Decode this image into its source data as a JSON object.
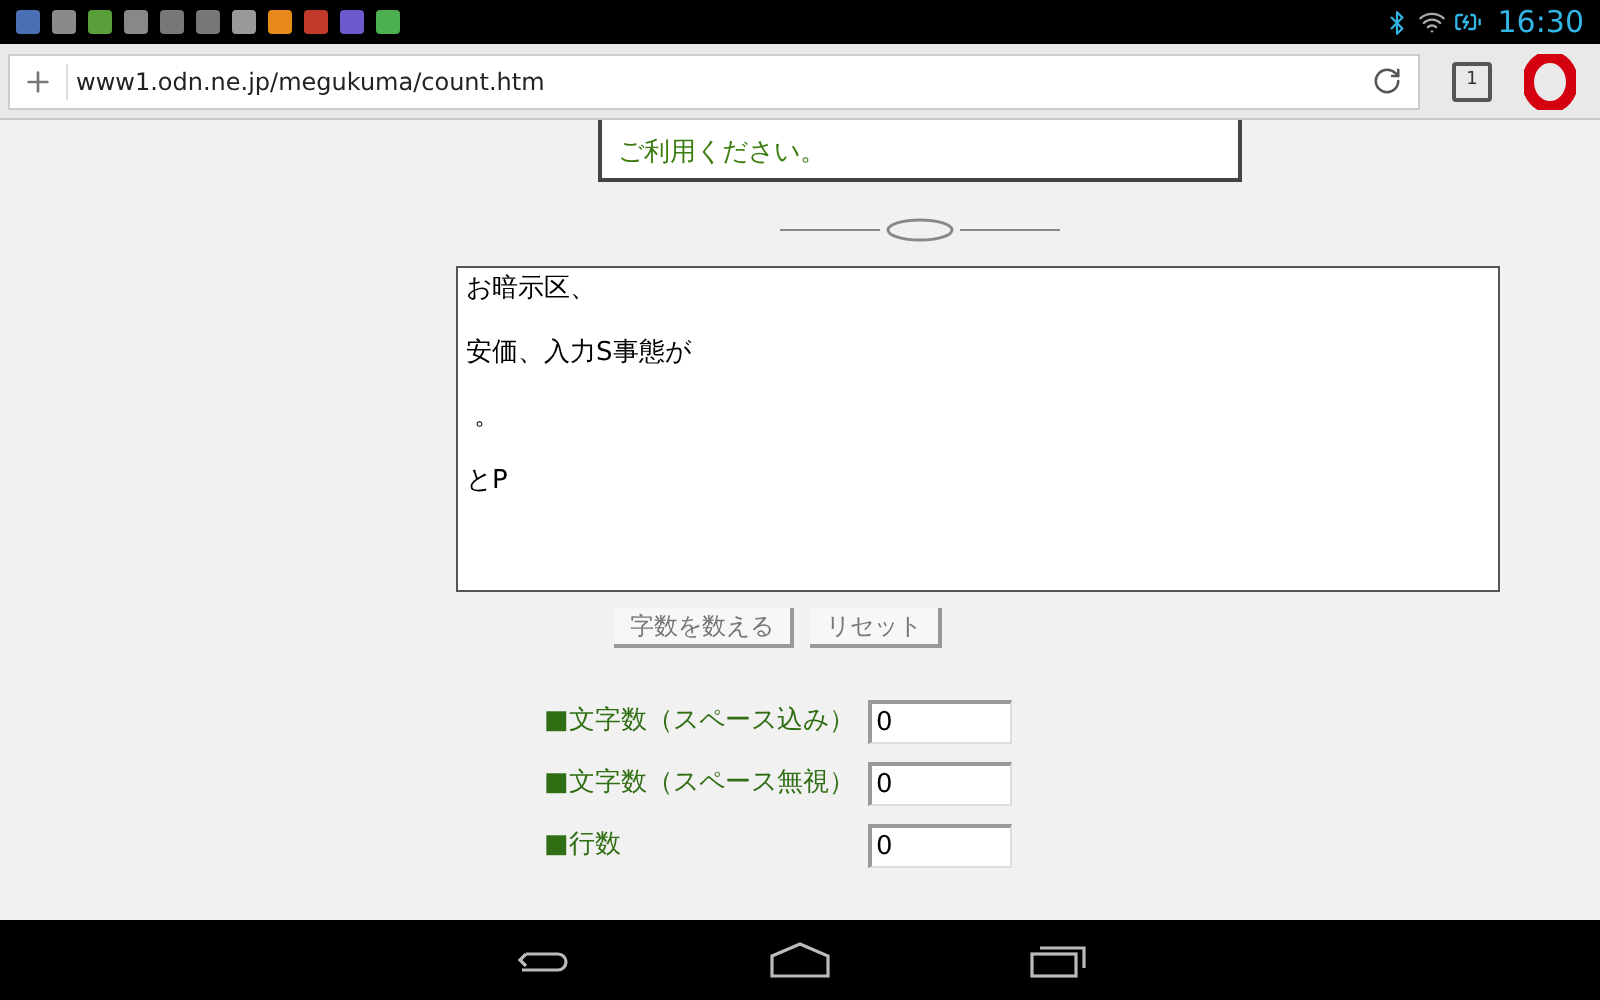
{
  "status_bar": {
    "time": "16:30"
  },
  "browser": {
    "url": "www1.odn.ne.jp/megukuma/count.htm",
    "tab_count": "1"
  },
  "notice": {
    "text": "ご利用ください。"
  },
  "editor": {
    "lines": [
      "お暗示区、",
      "安価、入力S事態が",
      " 。",
      "とP"
    ]
  },
  "buttons": [
    "字数を数える",
    "リセット"
  ],
  "results": [
    {
      "label": "■文字数（スペース込み）",
      "value": "0"
    },
    {
      "label": "■文字数（スペース無視）",
      "value": "0"
    },
    {
      "label": "■行数",
      "value": "0"
    }
  ]
}
